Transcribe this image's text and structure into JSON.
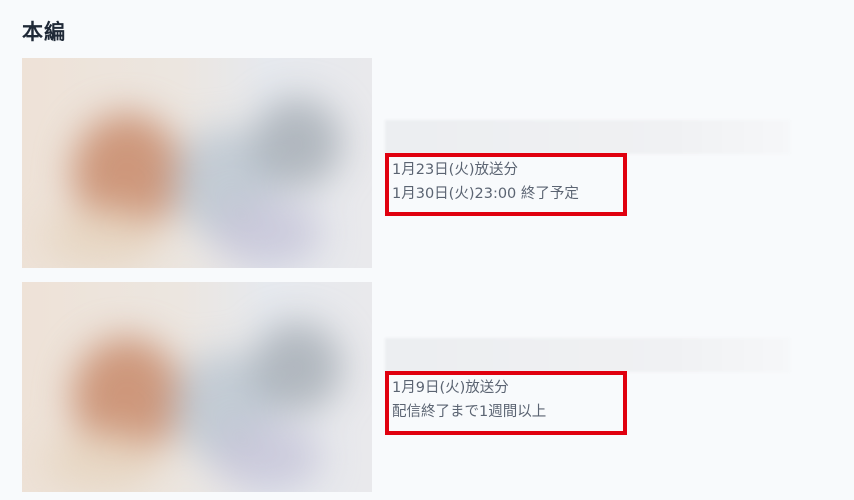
{
  "section": {
    "title": "本編"
  },
  "episodes": [
    {
      "broadcast": "1月23日(火)放送分",
      "availability": "1月30日(火)23:00 終了予定"
    },
    {
      "broadcast": "1月9日(火)放送分",
      "availability": "配信終了まで1週間以上"
    }
  ],
  "colors": {
    "highlight_border": "#e0000f",
    "page_bg": "#f8fafc"
  }
}
